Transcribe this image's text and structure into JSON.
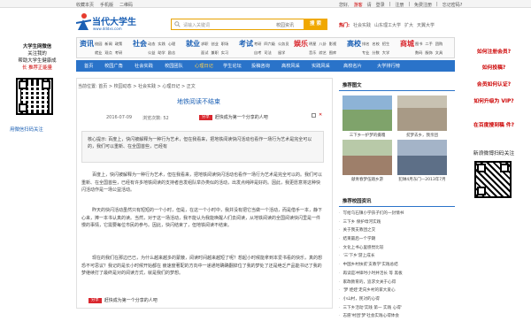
{
  "topbar": {
    "links": [
      "收藏本页",
      "手机版",
      "二维码"
    ],
    "right_items": [
      "您好,",
      "游客",
      "请",
      "登录",
      "|",
      "注册",
      "|",
      "免费注册",
      "|",
      "忘记密码?"
    ]
  },
  "logo": {
    "name": "当代大学生",
    "url": "www.dddxs.com"
  },
  "search": {
    "placeholder": "请输入关键词",
    "scope": "校园资讯",
    "button": "搜 索"
  },
  "hot": {
    "label": "热门:",
    "terms": [
      "社会实践",
      "山东理工大学",
      "扩大",
      "天翼大学"
    ]
  },
  "nav_groups": [
    {
      "big": "资讯",
      "links": [
        "校园",
        "新闻",
        "政策",
        "就业",
        "观点",
        "考研"
      ]
    },
    {
      "big": "社会",
      "links": [
        "动态",
        "实践",
        "心理",
        "公益",
        "助学",
        "励志"
      ]
    },
    {
      "big": "就业",
      "links": [
        "求职",
        "创业",
        "职场",
        "面试",
        "兼职",
        "实习"
      ]
    },
    {
      "big": "考试",
      "links": [
        "考研",
        "四六级",
        "公务员",
        "自考",
        "司法",
        "留学"
      ]
    },
    {
      "big": "娱乐",
      "links": [
        "明星",
        "八卦",
        "影视",
        "音乐",
        "综艺",
        "图库"
      ]
    },
    {
      "big": "高校",
      "links": [
        "排名",
        "名校",
        "招生",
        "专业",
        "分数",
        "大学"
      ]
    },
    {
      "big": "商城",
      "links": [
        "图书",
        "二手",
        "团购",
        "数码",
        "服饰",
        "文具"
      ]
    }
  ],
  "main_nav": [
    "首页",
    "校园广角",
    "社会实践",
    "校园团队",
    "心理日记",
    "学生论坛",
    "投稿咨询",
    "高校风采",
    "实践风采",
    "高校名片",
    "大学排行榜"
  ],
  "main_nav_current": "心理日记",
  "left_sidebar": {
    "title_lines": [
      "大学生网微信",
      "关注我的",
      "帮助大学生健康成",
      "长 推荐正能量"
    ],
    "scan_text": "用微信扫码关注"
  },
  "breadcrumb": "当前位置: 首页 > 校园动态 > 社会实践 > 心理日记 > 正文",
  "article": {
    "title": "地铁阅读不结束",
    "date": "2016-07-09",
    "views_label": "浏览次数:",
    "views": "52",
    "share_button": "分享",
    "share_text": "赶快成为第一个分享的人吧",
    "abstract": "核心提示: 百度上，快闪被解释为一种行为艺术，但在我看来，把地铁阅读快闪活动也看作一场行为艺术是完全可以的，我们可以重新、在全国首些，已经有",
    "paragraphs": [
      "百度上，快闪被解释为一种行为艺术，但在我看来，把地铁阅读快闪活动也看作一场行为艺术是完全可以的。我们可以重新、在全国首些，已经有许多地铁阅读的支持者自发组队举办类似的活动，出发点纯碎是好的。因此，我更愿意将这种快闪活动作是一场公益活动。",
      "昨天的快闪活动虽然只有短短的一个小时，但是，在这一个小时中，我并没有把它当做一个活动，而是借手一本，静下心来，捧一本书认真的读。当然，对于这一场活动，我不能认为我能唤醒人们去阅读，从地铁阅读的全国阅读快闪里是一件慢的事情，它需要每位市民的参与。因此，快闪结束了，但地铁阅读不结束。",
      "现在的我们在那边已已，为什么越来越多的蒙蔽，阅读时间越来越短了呢？想起小时候能拿到本爱书看的快乐，真的想恐不可思议？我记的是长小时候开始都在 疲速度著配的方向中一递通地确确翻掉位了我的梦处了还是绝乏产品能书记了我的梦继续打了最终是对的阅读方式，就是我们的梦想。"
    ]
  },
  "right": {
    "pics_title": "推荐图文",
    "pics": [
      {
        "caption": "三下乡一护梦的摄嘎",
        "color": "#7fa36b"
      },
      {
        "caption": "贫梦去乡，我亲团",
        "color": "#a89a86"
      },
      {
        "caption": "献青春梦伍踏乡游",
        "color": "#9e7f6a"
      },
      {
        "caption": "犯琳4月东门—2013年7月",
        "color": "#5d6f87"
      }
    ],
    "news_title": "推荐校园资讯",
    "news": [
      "写给乌石镇小学孩子们的一封情书",
      "三下乡 保护母河实践",
      "关于我支教团之交",
      "结束最后一个学期",
      "文化上书心里感觉比较",
      "'三'下乡'游上成长",
      "中国乡村扶贫'支教学'实践总结",
      "再读是冲锋时小时并活长 等 黑板",
      "家政教育的，追求文关于心得",
      "'梦 娃娃'走向乡村的家大爱心",
      "小山村，民对的心得",
      "三下乡活动'实践 第一 实践 心得'",
      "志愿'村团'梦'社会实践心得体会"
    ]
  },
  "far_right": {
    "questions": [
      "如何注册会员?",
      "如何投稿?",
      "会员如何认证?",
      "如何升级为 VIP?",
      "在百度搜到稿 件?"
    ],
    "scan_text": "新浪微博扫码关注"
  }
}
